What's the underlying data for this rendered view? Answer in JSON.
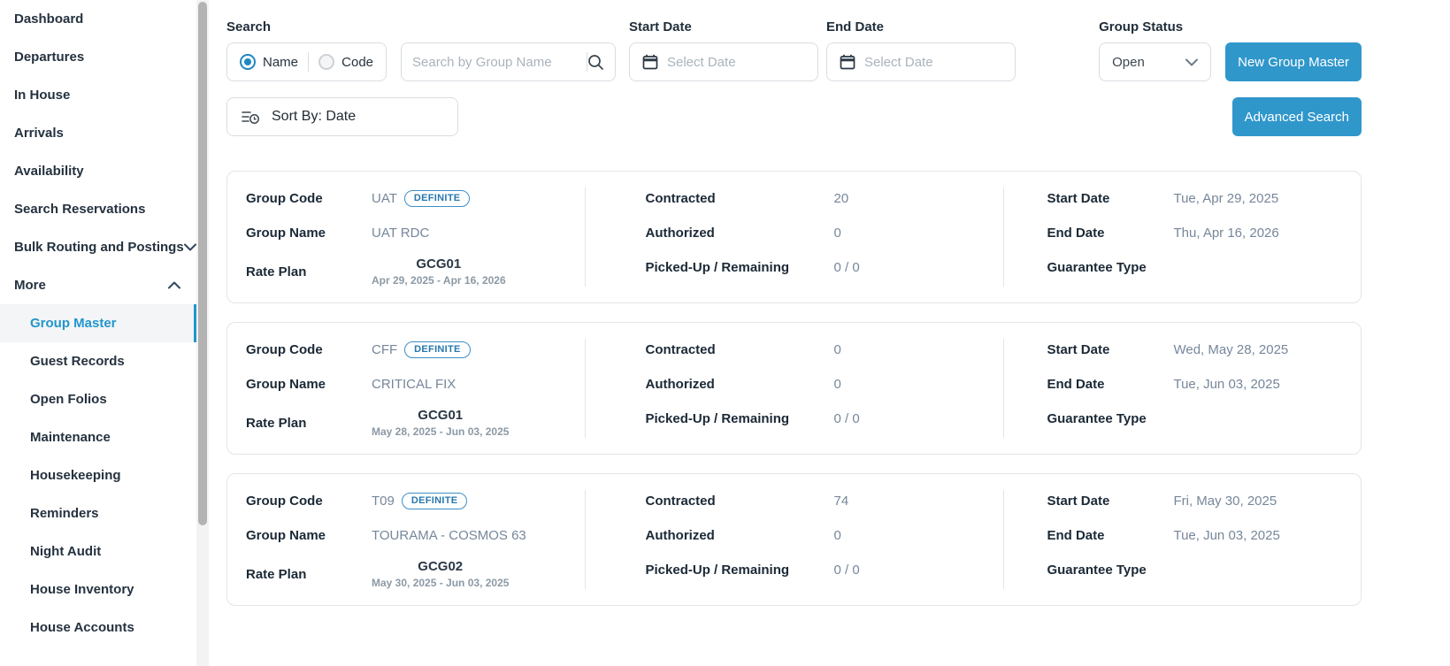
{
  "colors": {
    "accent_button": "#3097cb",
    "selected_link": "#2196cc",
    "badge_blue": "#2e86c0",
    "value_slate": "#76879a"
  },
  "sidebar": {
    "items": [
      {
        "label": "Dashboard"
      },
      {
        "label": "Departures"
      },
      {
        "label": "In House"
      },
      {
        "label": "Arrivals"
      },
      {
        "label": "Availability"
      },
      {
        "label": "Search Reservations"
      },
      {
        "label": "Bulk Routing and Postings",
        "chevron": "down"
      },
      {
        "label": "More",
        "chevron": "up"
      }
    ],
    "sub_items": [
      {
        "label": "Group Master",
        "selected": true
      },
      {
        "label": "Guest Records"
      },
      {
        "label": "Open Folios"
      },
      {
        "label": "Maintenance"
      },
      {
        "label": "Housekeeping"
      },
      {
        "label": "Reminders"
      },
      {
        "label": "Night Audit"
      },
      {
        "label": "House Inventory"
      },
      {
        "label": "House Accounts"
      }
    ]
  },
  "filters": {
    "search_label": "Search",
    "radio_name": "Name",
    "radio_code": "Code",
    "radio_selected": "Name",
    "search_placeholder": "Search by Group Name",
    "start_date_label": "Start Date",
    "end_date_label": "End Date",
    "date_placeholder": "Select Date",
    "group_status_label": "Group Status",
    "group_status_value": "Open",
    "new_group_master_button": "New Group Master",
    "sort_by_button": "Sort By: Date",
    "advanced_search_button": "Advanced Search"
  },
  "card_labels": {
    "group_code": "Group Code",
    "group_name": "Group Name",
    "rate_plan": "Rate Plan",
    "contracted": "Contracted",
    "authorized": "Authorized",
    "picked_up_remaining": "Picked-Up / Remaining",
    "start_date": "Start Date",
    "end_date": "End Date",
    "guarantee_type": "Guarantee Type"
  },
  "cards": [
    {
      "group_code": "UAT",
      "status_badge": "DEFINITE",
      "group_name": "UAT RDC",
      "rate_plan": "GCG01",
      "rate_plan_dates": "Apr 29, 2025 - Apr 16, 2026",
      "contracted": "20",
      "authorized": "0",
      "picked_up_remaining": "0 / 0",
      "start_date": "Tue, Apr 29, 2025",
      "end_date": "Thu, Apr 16, 2026",
      "guarantee_type": ""
    },
    {
      "group_code": "CFF",
      "status_badge": "DEFINITE",
      "group_name": "CRITICAL FIX",
      "rate_plan": "GCG01",
      "rate_plan_dates": "May 28, 2025 - Jun 03, 2025",
      "contracted": "0",
      "authorized": "0",
      "picked_up_remaining": "0 / 0",
      "start_date": "Wed, May 28, 2025",
      "end_date": "Tue, Jun 03, 2025",
      "guarantee_type": ""
    },
    {
      "group_code": "T09",
      "status_badge": "DEFINITE",
      "group_name": "TOURAMA - COSMOS 63",
      "rate_plan": "GCG02",
      "rate_plan_dates": "May 30, 2025 - Jun 03, 2025",
      "contracted": "74",
      "authorized": "0",
      "picked_up_remaining": "0 / 0",
      "start_date": "Fri, May 30, 2025",
      "end_date": "Tue, Jun 03, 2025",
      "guarantee_type": ""
    }
  ]
}
